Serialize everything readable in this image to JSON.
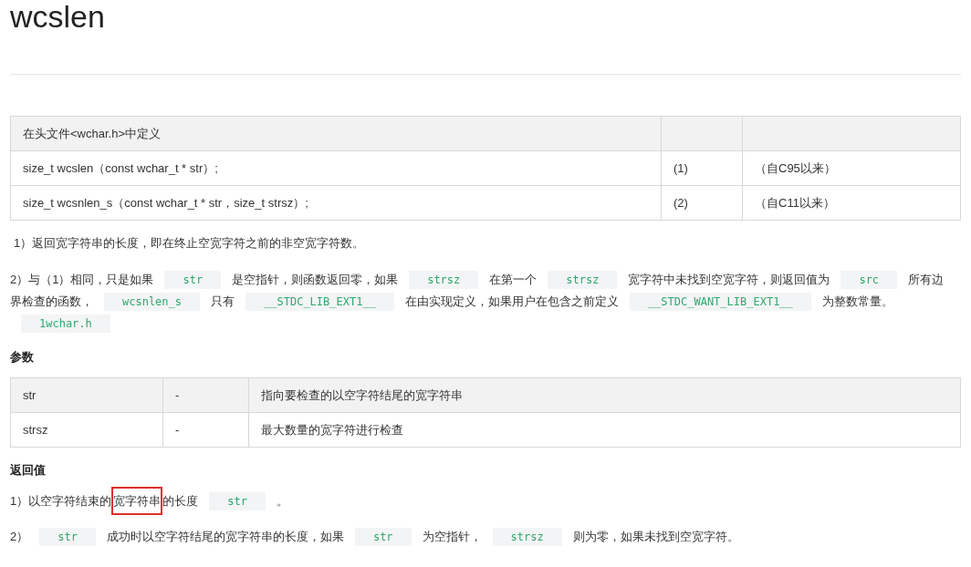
{
  "title": "wcslen",
  "definition_table": {
    "header": "在头文件<wchar.h>中定义",
    "rows": [
      {
        "signature": "size_t wcslen（const wchar_t * str）;",
        "index": "(1)",
        "since": "（自C95以来）"
      },
      {
        "signature": "size_t wcsnlen_s（const wchar_t * str，size_t strsz）;",
        "index": "(2)",
        "since": "（自C11以来）"
      }
    ]
  },
  "description": [
    {
      "segments": [
        {
          "kind": "text",
          "text": "1）返回宽字符串的长度，即在终止空宽字符之前的非空宽字符数。"
        }
      ]
    },
    {
      "segments": [
        {
          "kind": "text",
          "text": "2）与（1）相同，只是如果"
        },
        {
          "kind": "code",
          "text": "str"
        },
        {
          "kind": "text",
          "text": "是空指针，则函数返回零，如果"
        },
        {
          "kind": "code",
          "text": "strsz"
        },
        {
          "kind": "text",
          "text": "在第一个"
        },
        {
          "kind": "code",
          "text": "strsz"
        },
        {
          "kind": "text",
          "text": "宽字符中未找到空宽字符，则返回值为"
        },
        {
          "kind": "code",
          "text": "src"
        },
        {
          "kind": "text",
          "text": "所有边"
        },
        {
          "kind": "text",
          "text": "界检查的函数，"
        },
        {
          "kind": "code",
          "text": "wcsnlen_s"
        },
        {
          "kind": "text",
          "text": "只有"
        },
        {
          "kind": "code",
          "text": "__STDC_LIB_EXT1__"
        },
        {
          "kind": "text",
          "text": "在由实现定义，如果用户在包含之前定义"
        },
        {
          "kind": "code",
          "text": "__STDC_WANT_LIB_EXT1__"
        },
        {
          "kind": "text",
          "text": "为整数常量。"
        },
        {
          "kind": "code",
          "text": "1wchar.h"
        }
      ]
    }
  ],
  "parameters": {
    "heading": "参数",
    "rows": [
      {
        "name": "str",
        "dash": "-",
        "description": "指向要检查的以空字符结尾的宽字符串"
      },
      {
        "name": "strsz",
        "dash": "-",
        "description": "最大数量的宽字符进行检查"
      }
    ]
  },
  "return_value": {
    "heading": "返回值",
    "paragraphs": [
      {
        "segments": [
          {
            "kind": "text",
            "text": "1）以空字符结束的"
          },
          {
            "kind": "highlight",
            "text": "宽字符串"
          },
          {
            "kind": "text",
            "text": "的长度"
          },
          {
            "kind": "code",
            "text": "str"
          },
          {
            "kind": "text",
            "text": "。"
          }
        ]
      },
      {
        "segments": [
          {
            "kind": "text",
            "text": "2）"
          },
          {
            "kind": "code",
            "text": "str"
          },
          {
            "kind": "text",
            "text": "成功时以空字符结尾的宽字符串的长度，如果"
          },
          {
            "kind": "code",
            "text": "str"
          },
          {
            "kind": "text",
            "text": "为空指针，"
          },
          {
            "kind": "code",
            "text": "strsz"
          },
          {
            "kind": "text",
            "text": "则为零，如果未找到空宽字符。"
          }
        ]
      }
    ]
  }
}
